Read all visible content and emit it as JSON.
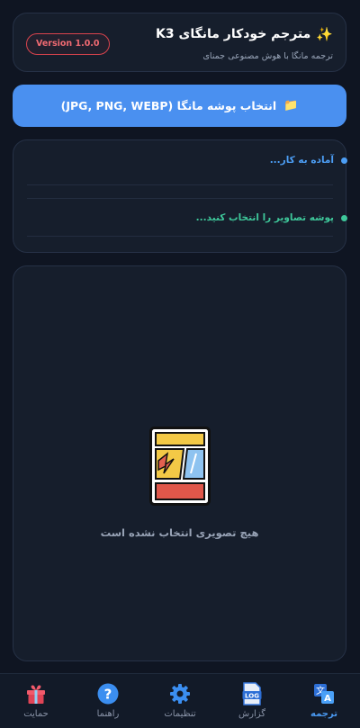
{
  "header": {
    "title": "مترجم خودکار مانگای K3",
    "subtitle": "ترجمه مانگا با هوش مصنوعی جمنای",
    "version_badge": "Version 1.0.0"
  },
  "select_button": {
    "label": "انتخاب پوشه مانگا (JPG, PNG, WEBP)"
  },
  "status": {
    "line1": "آماده به کار...",
    "line2": "پوشه تصاویر را انتخاب کنید..."
  },
  "preview": {
    "empty_text": "هیچ تصویری انتخاب نشده است"
  },
  "bottom_nav": {
    "items": [
      {
        "label": "ترجمه",
        "icon": "translate-icon",
        "active": true
      },
      {
        "label": "گزارش",
        "icon": "log-icon",
        "active": false
      },
      {
        "label": "تنظیمات",
        "icon": "gear-icon",
        "active": false
      },
      {
        "label": "راهنما",
        "icon": "help-icon",
        "active": false
      },
      {
        "label": "حمایت",
        "icon": "gift-icon",
        "active": false
      }
    ]
  },
  "colors": {
    "accent": "#4a90f0",
    "badge_red": "#d9434d",
    "status_blue": "#4c9ef5",
    "status_green": "#3ec79a"
  }
}
